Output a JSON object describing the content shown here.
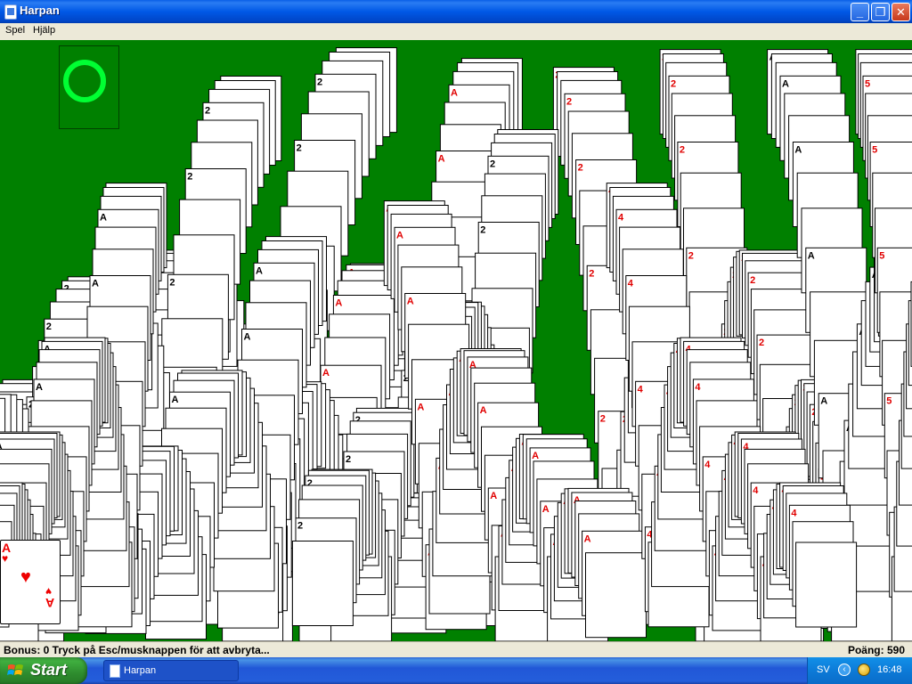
{
  "window": {
    "title": "Harpan",
    "minimize_glyph": "_",
    "maximize_glyph": "❐",
    "close_glyph": "✕"
  },
  "menu": {
    "items": [
      "Spel",
      "Hjälp"
    ]
  },
  "game": {
    "felt_color": "#008000",
    "recycle_ring_color": "#00ff33",
    "card_red": "#e00000",
    "last_card": {
      "rank": "A",
      "suit": "♥"
    }
  },
  "status": {
    "bonus": "Bonus: 0  Tryck på Esc/musknappen för att avbryta...",
    "score": "Poäng: 590"
  },
  "taskbar": {
    "start_label": "Start",
    "task_label": "Harpan",
    "language": "SV",
    "clock": "16:48",
    "chevron_glyph": "‹"
  }
}
